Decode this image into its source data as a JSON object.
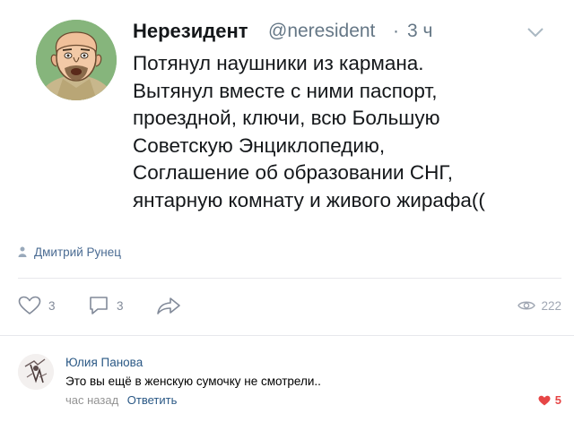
{
  "tweet": {
    "name": "Нерезидент",
    "handle": "@neresident",
    "separator": "·",
    "time": "3 ч",
    "text_lines": [
      "Потянул наушники из кармана.",
      "Вытянул вместе с ними паспорт,",
      "проездной, ключи, всю Большую",
      "Советскую Энциклопедию,",
      "Соглашение об образовании СНГ,",
      "янтарную комнату и живого жирафа(("
    ],
    "avatar_icon": "cartoon-man-avatar",
    "menu_icon": "chevron-down-icon"
  },
  "author": {
    "icon": "person-icon",
    "name": "Дмитрий Рунец"
  },
  "actions": {
    "likes": "3",
    "comments": "3",
    "views": "222",
    "like_icon": "heart-icon",
    "comment_icon": "comment-icon",
    "share_icon": "share-icon",
    "views_icon": "eye-icon"
  },
  "comment": {
    "author": "Юлия Панова",
    "text": "Это вы ещё в женскую сумочку не смотрели..",
    "time": "час назад",
    "reply_label": "Ответить",
    "likes": "5",
    "like_color": "#e64646"
  },
  "colors": {
    "link": "#2a5885",
    "muted": "#828a99",
    "divider": "#e7e8ec"
  }
}
